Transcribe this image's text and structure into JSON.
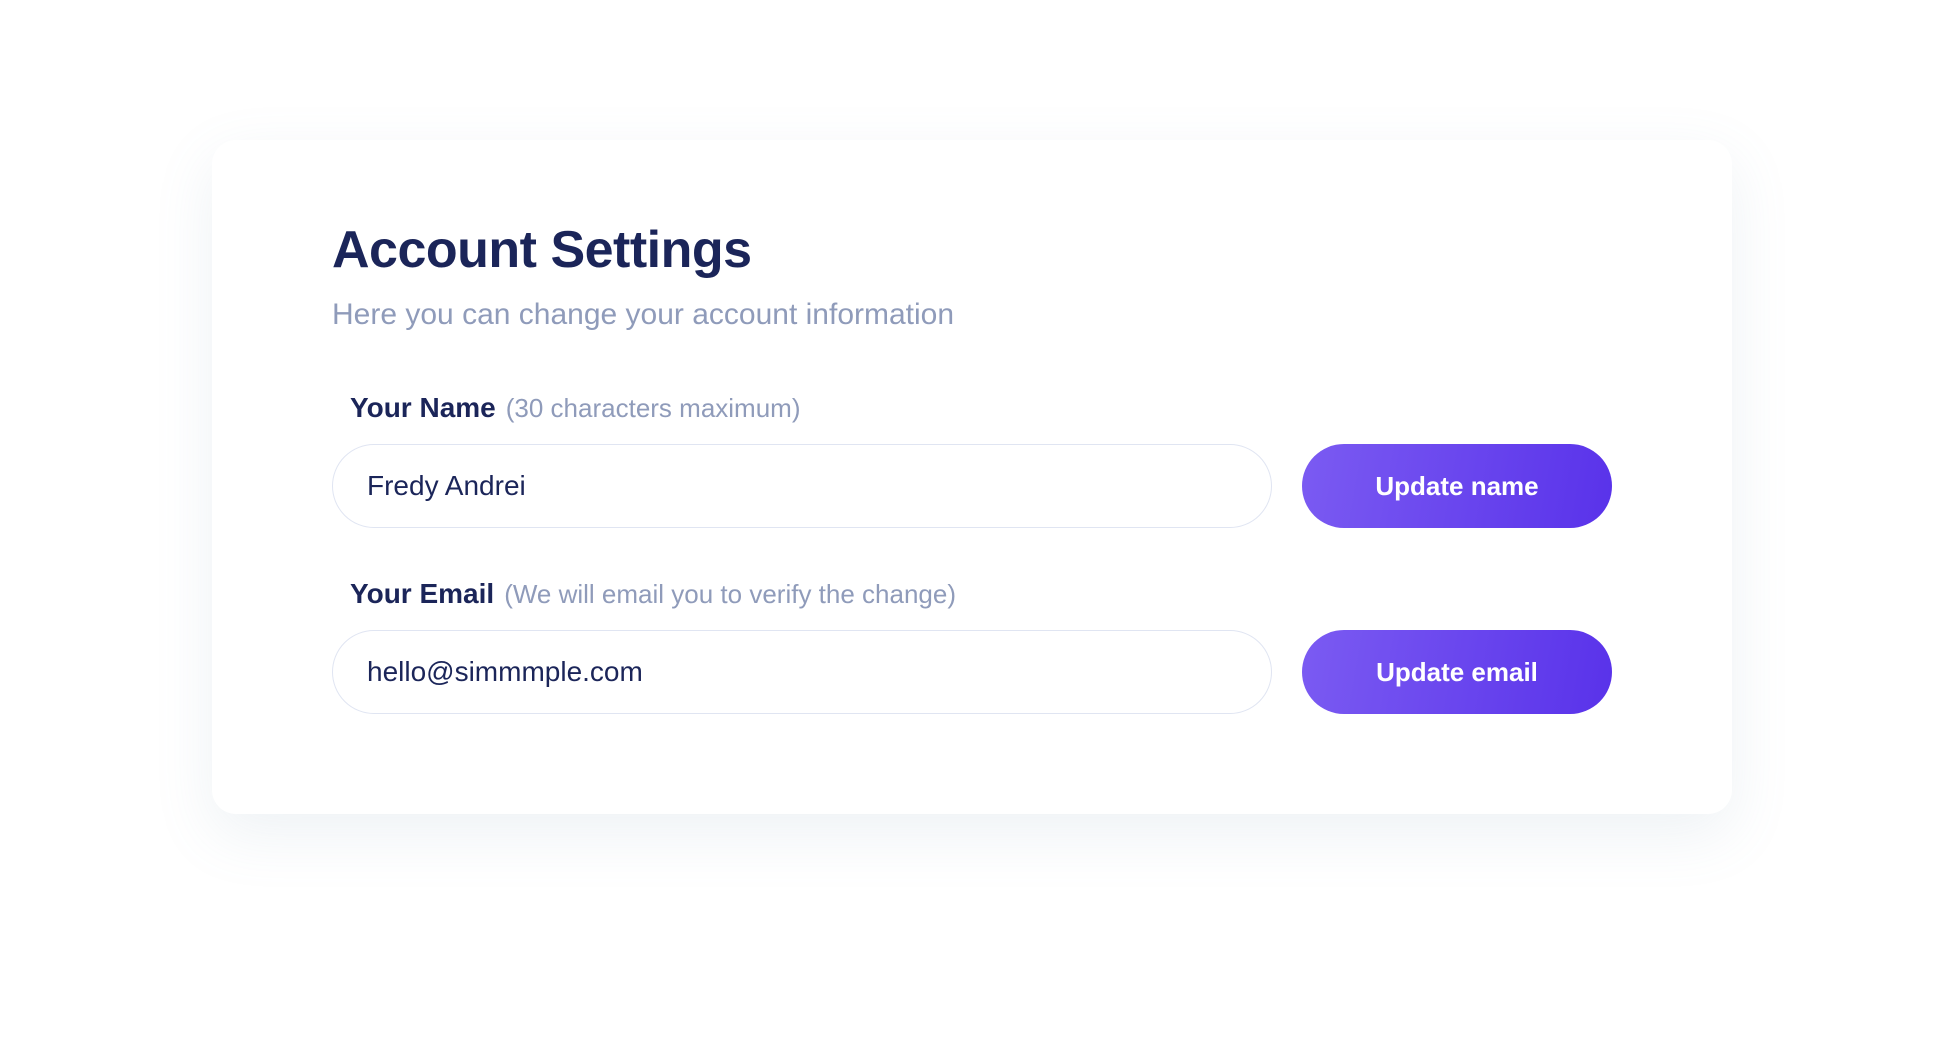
{
  "header": {
    "title": "Account Settings",
    "subtitle": "Here you can change your account information"
  },
  "fields": {
    "name": {
      "label": "Your Name",
      "hint": "(30 characters maximum)",
      "value": "Fredy Andrei",
      "button": "Update name"
    },
    "email": {
      "label": "Your Email",
      "hint": "(We will email you to verify the change)",
      "value": "hello@simmmple.com",
      "button": "Update email"
    }
  }
}
